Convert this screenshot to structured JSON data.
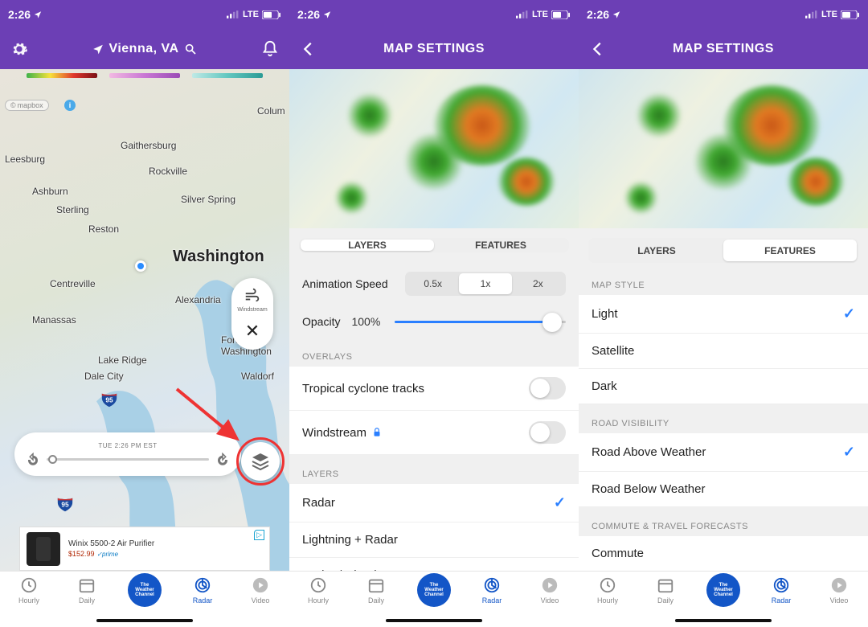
{
  "status": {
    "time": "2:26",
    "network": "LTE"
  },
  "screen1": {
    "location": "Vienna, VA",
    "timeline_label": "TUE 2:26 PM EST",
    "windstream_label": "Windstream",
    "mapbox": "mapbox",
    "cities": {
      "washington": "Washington",
      "gaithersburg": "Gaithersburg",
      "rockville": "Rockville",
      "silverspring": "Silver Spring",
      "reston": "Reston",
      "sterling": "Sterling",
      "ashburn": "Ashburn",
      "leesburg": "Leesburg",
      "centreville": "Centreville",
      "manassas": "Manassas",
      "dalecity": "Dale City",
      "lakeridge": "Lake Ridge",
      "fortwash": "Fort\nWashington",
      "waldorf": "Waldorf",
      "alexandria": "Alexandria",
      "colum": "Colum"
    },
    "ad": {
      "title": "Winix 5500-2 Air Purifier",
      "price": "$152.99",
      "prime": "✓prime"
    }
  },
  "settings_title": "MAP SETTINGS",
  "tabs": {
    "layers": "LAYERS",
    "features": "FEATURES"
  },
  "screen2": {
    "anim_label": "Animation Speed",
    "speeds": {
      "half": "0.5x",
      "one": "1x",
      "two": "2x"
    },
    "opacity_label": "Opacity",
    "opacity_value": "100%",
    "sect_overlays": "OVERLAYS",
    "tropical": "Tropical cyclone tracks",
    "windstream": "Windstream",
    "sect_layers": "LAYERS",
    "radar": "Radar",
    "lightning": "Lightning + Radar",
    "radar_clouds": "Radar / Clouds"
  },
  "screen3": {
    "sect_mapstyle": "MAP STYLE",
    "light": "Light",
    "satellite": "Satellite",
    "dark": "Dark",
    "sect_road": "ROAD VISIBILITY",
    "road_above": "Road Above Weather",
    "road_below": "Road Below Weather",
    "sect_commute": "COMMUTE & TRAVEL FORECASTS",
    "commute": "Commute"
  },
  "tabbar": {
    "hourly": "Hourly",
    "daily": "Daily",
    "logo": "The\nWeather\nChannel",
    "radar": "Radar",
    "video": "Video"
  }
}
